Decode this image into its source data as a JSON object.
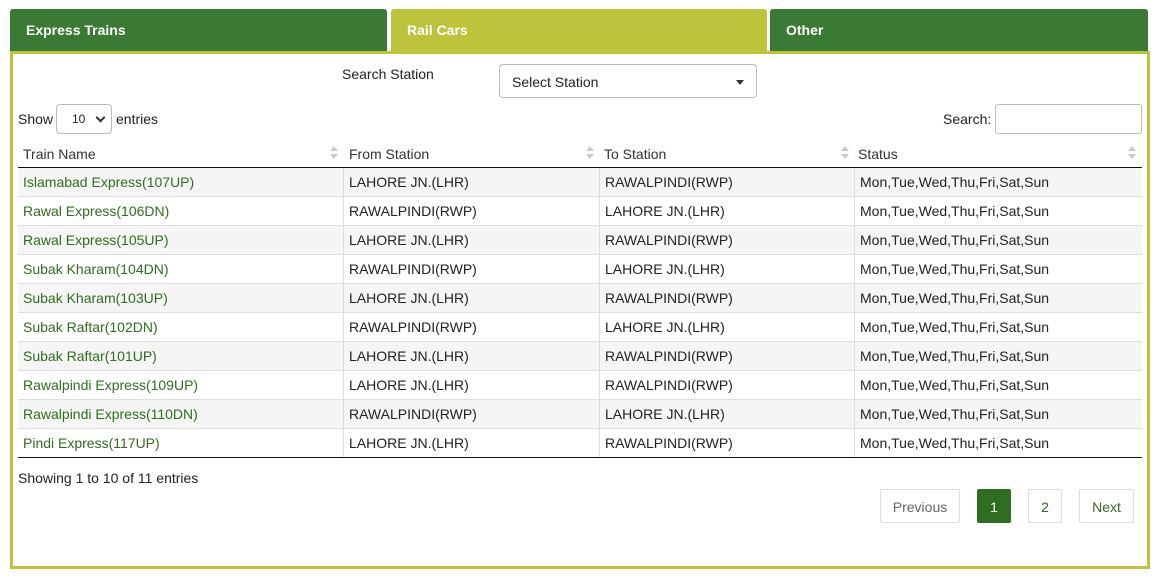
{
  "tabs": [
    {
      "label": "Express Trains"
    },
    {
      "label": "Rail Cars"
    },
    {
      "label": "Other"
    }
  ],
  "station_filter": {
    "label": "Search Station",
    "selected": "Select Station"
  },
  "length_control": {
    "show_label": "Show",
    "value": "10",
    "entries_label": "entries"
  },
  "search": {
    "label": "Search:",
    "value": ""
  },
  "table": {
    "columns": [
      "Train Name",
      "From Station",
      "To Station",
      "Status"
    ],
    "rows": [
      [
        "Islamabad Express(107UP)",
        "LAHORE JN.(LHR)",
        "RAWALPINDI(RWP)",
        "Mon,Tue,Wed,Thu,Fri,Sat,Sun"
      ],
      [
        "Rawal Express(106DN)",
        "RAWALPINDI(RWP)",
        "LAHORE JN.(LHR)",
        "Mon,Tue,Wed,Thu,Fri,Sat,Sun"
      ],
      [
        "Rawal Express(105UP)",
        "LAHORE JN.(LHR)",
        "RAWALPINDI(RWP)",
        "Mon,Tue,Wed,Thu,Fri,Sat,Sun"
      ],
      [
        "Subak Kharam(104DN)",
        "RAWALPINDI(RWP)",
        "LAHORE JN.(LHR)",
        "Mon,Tue,Wed,Thu,Fri,Sat,Sun"
      ],
      [
        "Subak Kharam(103UP)",
        "LAHORE JN.(LHR)",
        "RAWALPINDI(RWP)",
        "Mon,Tue,Wed,Thu,Fri,Sat,Sun"
      ],
      [
        "Subak Raftar(102DN)",
        "RAWALPINDI(RWP)",
        "LAHORE JN.(LHR)",
        "Mon,Tue,Wed,Thu,Fri,Sat,Sun"
      ],
      [
        "Subak Raftar(101UP)",
        "LAHORE JN.(LHR)",
        "RAWALPINDI(RWP)",
        "Mon,Tue,Wed,Thu,Fri,Sat,Sun"
      ],
      [
        "Rawalpindi Express(109UP)",
        "LAHORE JN.(LHR)",
        "RAWALPINDI(RWP)",
        "Mon,Tue,Wed,Thu,Fri,Sat,Sun"
      ],
      [
        "Rawalpindi Express(110DN)",
        "RAWALPINDI(RWP)",
        "LAHORE JN.(LHR)",
        "Mon,Tue,Wed,Thu,Fri,Sat,Sun"
      ],
      [
        "Pindi Express(117UP)",
        "LAHORE JN.(LHR)",
        "RAWALPINDI(RWP)",
        "Mon,Tue,Wed,Thu,Fri,Sat,Sun"
      ]
    ]
  },
  "info": "Showing 1 to 10 of 11 entries",
  "pagination": {
    "previous": "Previous",
    "pages": [
      "1",
      "2"
    ],
    "next": "Next"
  },
  "colors": {
    "tab_green": "#3a7a35",
    "tab_active": "#bdc43c",
    "link_green": "#2f6e1e"
  }
}
